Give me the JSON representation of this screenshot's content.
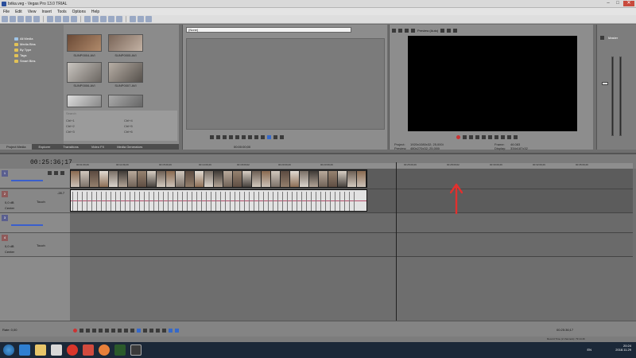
{
  "window": {
    "title": "bıtka.veg - Vegas Pro 13.0 TRIAL"
  },
  "menu": [
    "File",
    "Edit",
    "View",
    "Insert",
    "Tools",
    "Options",
    "Help"
  ],
  "explorer": {
    "tree": [
      "All Media",
      "Media Bins",
      "By Type",
      "Tags",
      "Smart Bins"
    ],
    "thumbs": [
      "SUNP0004.AVI",
      "SUNP0005.AVI",
      "SUNP0006.AVI",
      "SUNP0007.AVI"
    ],
    "search_placeholder": "Search",
    "shortcuts": [
      "Ctrl+1",
      "Ctrl+4",
      "Ctrl+2",
      "Ctrl+5",
      "Ctrl+3",
      "Ctrl+6"
    ],
    "tabs": [
      "Project Media",
      "Explorer",
      "Transitions",
      "Video FX",
      "Media Generators"
    ]
  },
  "trimmer": {
    "dropdown": "(None)",
    "time": "00:00:00;00"
  },
  "preview": {
    "label": "Preview (Auto)",
    "project_label": "Project:",
    "project_value": "1920x1080x32; 25,000i",
    "preview_label": "Preview:",
    "preview_value": "480x270x32; 25,000i",
    "frame_label": "Frame:",
    "frame_value": "46.083",
    "display_label": "Display:",
    "display_value": "334x187x32"
  },
  "master": {
    "label": "Master"
  },
  "timeline": {
    "time": "00:25:36;17",
    "ruler": [
      "00:01:09;29",
      "00:11:09;29",
      "00:15:09;29",
      "00:14:09;29",
      "00:18:09;02",
      "00:20:09;29",
      "00:23:09;29",
      "00:25:09;29",
      "00:28:09;02",
      "00:30:09;29",
      "00:32:09;29",
      "00:35:09;29",
      "00:38:09;29"
    ],
    "tracks": [
      {
        "num": "1",
        "type": "video"
      },
      {
        "num": "2",
        "type": "audio",
        "db": "0,0 dB",
        "pan": "Center",
        "mode": "Touch",
        "level": "-28.7"
      },
      {
        "num": "3",
        "type": "video"
      },
      {
        "num": "4",
        "type": "audio",
        "db": "0,0 dB",
        "pan": "Center",
        "mode": "Touch"
      }
    ]
  },
  "bottom": {
    "rate": "Rate: 0,00",
    "time": "00:25:36;17",
    "record": "Record Time (2 channels): 79:14:46"
  },
  "taskbar": {
    "lang": "EN",
    "clock": "20:24",
    "date": "2018.11.29"
  },
  "colors": {
    "accent": "#3669c9",
    "video_track": "#5a5f8f",
    "audio_track": "#8f5a5a",
    "annotation": "#e2302e"
  }
}
